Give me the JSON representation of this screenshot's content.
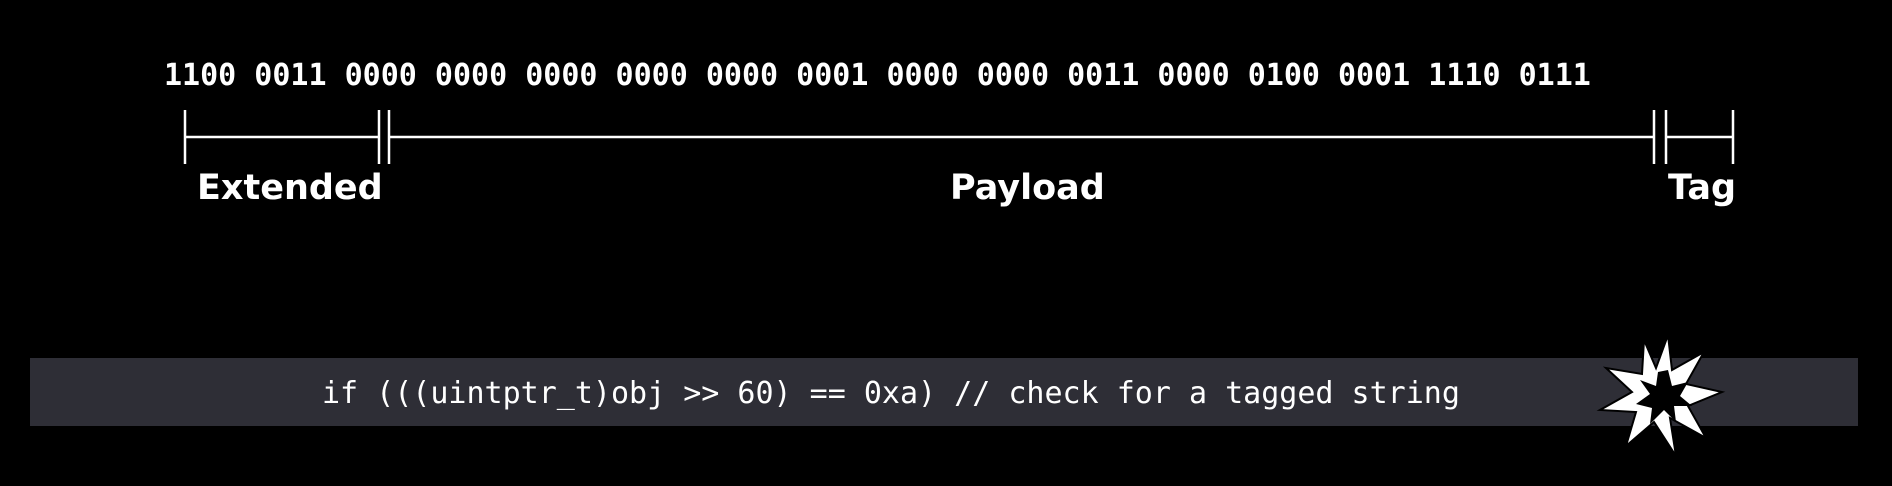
{
  "bit_pattern": "1100 0011 0000 0000 0000 0000 0000 0001 0000 0000 0011 0000 0100 0001 1110 0111",
  "fields": {
    "extended": "Extended",
    "payload": "Payload",
    "tag": "Tag"
  },
  "code": "if (((uintptr_t)obj >> 60) == 0xa) // check for a tagged string",
  "colors": {
    "background": "#000000",
    "code_bar": "#2e2e36",
    "foreground": "#ffffff"
  },
  "icons": {
    "burst": "explosion-burst-icon"
  }
}
